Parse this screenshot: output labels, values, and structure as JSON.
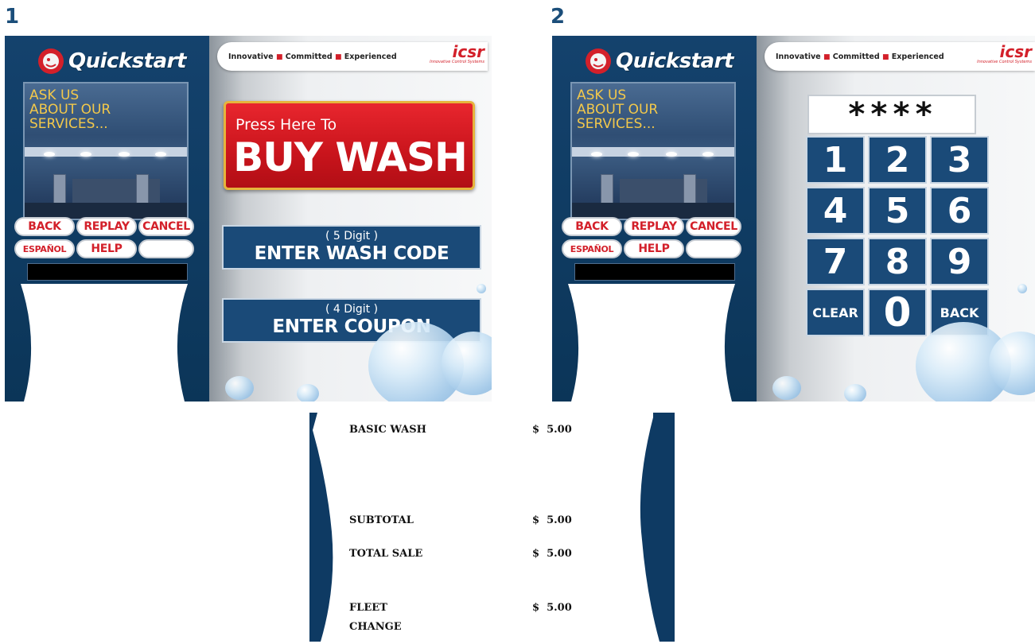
{
  "step_labels": {
    "first": "1",
    "second": "2"
  },
  "brand": {
    "logo_text": "Quickstart",
    "tagline_1": "Innovative",
    "tagline_2": "Committed",
    "tagline_3": "Experienced",
    "company": "icsr",
    "company_sub": "Innovative Control Systems"
  },
  "sidebar": {
    "promo_line1": "ASK US",
    "promo_line2": "ABOUT OUR",
    "promo_line3": "SERVICES...",
    "buttons": {
      "back": "BACK",
      "replay": "REPLAY",
      "cancel": "CANCEL",
      "espanol": "ESPAÑOL",
      "help": "HELP"
    }
  },
  "screen1": {
    "buy_pre": "Press Here To",
    "buy_main": "BUY WASH",
    "wash_code_sub": "( 5 Digit )",
    "wash_code_main": "ENTER WASH CODE",
    "coupon_sub": "( 4 Digit )",
    "coupon_main": "ENTER COUPON"
  },
  "screen2": {
    "pin_display": "****",
    "keys": {
      "k1": "1",
      "k2": "2",
      "k3": "3",
      "k4": "4",
      "k5": "5",
      "k6": "6",
      "k7": "7",
      "k8": "8",
      "k9": "9",
      "k0": "0",
      "clear": "CLEAR",
      "back": "BACK"
    }
  },
  "receipt": {
    "items": [
      {
        "label": "BASIC WASH",
        "amount": "$  5.00"
      },
      {
        "label": "SUBTOTAL",
        "amount": "$  5.00"
      },
      {
        "label": "TOTAL SALE",
        "amount": "$  5.00"
      },
      {
        "label": "FLEET",
        "amount": "$  5.00"
      },
      {
        "label": "CHANGE",
        "amount": ""
      }
    ]
  },
  "colors": {
    "navy": "#14426d",
    "accent_red": "#d3202a",
    "promo_yellow": "#f2c84b",
    "button_blue": "#1a4a78"
  }
}
